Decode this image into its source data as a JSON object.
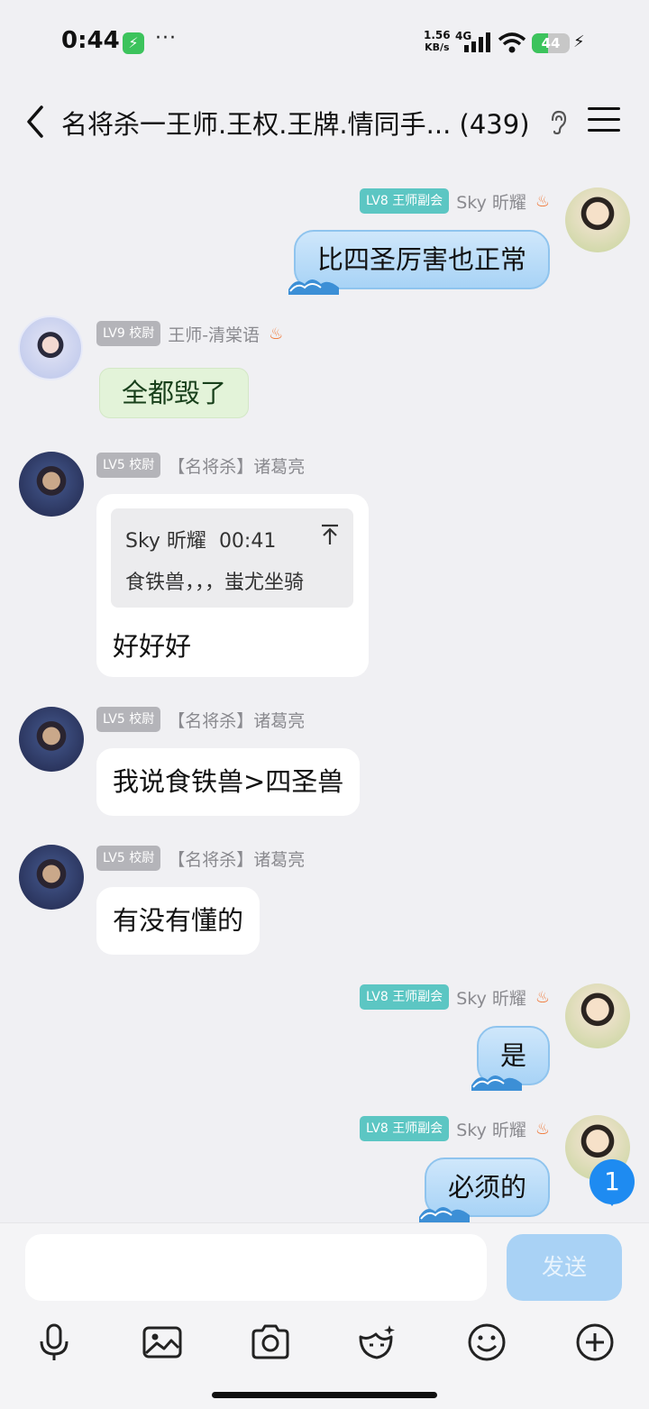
{
  "status_bar": {
    "time": "0:44",
    "speed_value": "1.56",
    "speed_unit": "KB/s",
    "network": "4G",
    "battery": "44",
    "battery_level": 0.44
  },
  "header": {
    "title": "名将杀一王师.王权.王牌.情同手... (439)"
  },
  "messages": [
    {
      "sender": "Sky 昕耀",
      "level": "LV8",
      "title": "王师副会",
      "text": "比四圣厉害也正常"
    },
    {
      "sender": "王师-清棠语",
      "level": "LV9",
      "title": "校尉",
      "text": "全都毁了"
    },
    {
      "sender": "【名将杀】诸葛亮",
      "level": "LV5",
      "title": "校尉",
      "quote": {
        "author": "Sky 昕耀",
        "time": "00:41",
        "text": "食铁兽，，，蚩尤坐骑"
      },
      "text": "好好好"
    },
    {
      "sender": "【名将杀】诸葛亮",
      "level": "LV5",
      "title": "校尉",
      "text": "我说食铁兽>四圣兽"
    },
    {
      "sender": "【名将杀】诸葛亮",
      "level": "LV5",
      "title": "校尉",
      "text": "有没有懂的"
    },
    {
      "sender": "Sky 昕耀",
      "level": "LV8",
      "title": "王师副会",
      "text": "是"
    },
    {
      "sender": "Sky 昕耀",
      "level": "LV8",
      "title": "王师副会",
      "text": "必须的"
    }
  ],
  "unread_count": "1",
  "input": {
    "value": "",
    "send_label": "发送"
  },
  "toolbar": {
    "icons": [
      "microphone-icon",
      "image-icon",
      "camera-icon",
      "sticker-icon",
      "emoji-icon",
      "plus-icon"
    ]
  },
  "colors": {
    "background": "#f0f0f3",
    "sent_bubble": "#a8d3f6",
    "level_badge_teal": "#5cc6c3",
    "level_badge_gray": "#b4b4b9",
    "unread_badge": "#1e8bf1",
    "send_button": "#a9d2f5"
  }
}
